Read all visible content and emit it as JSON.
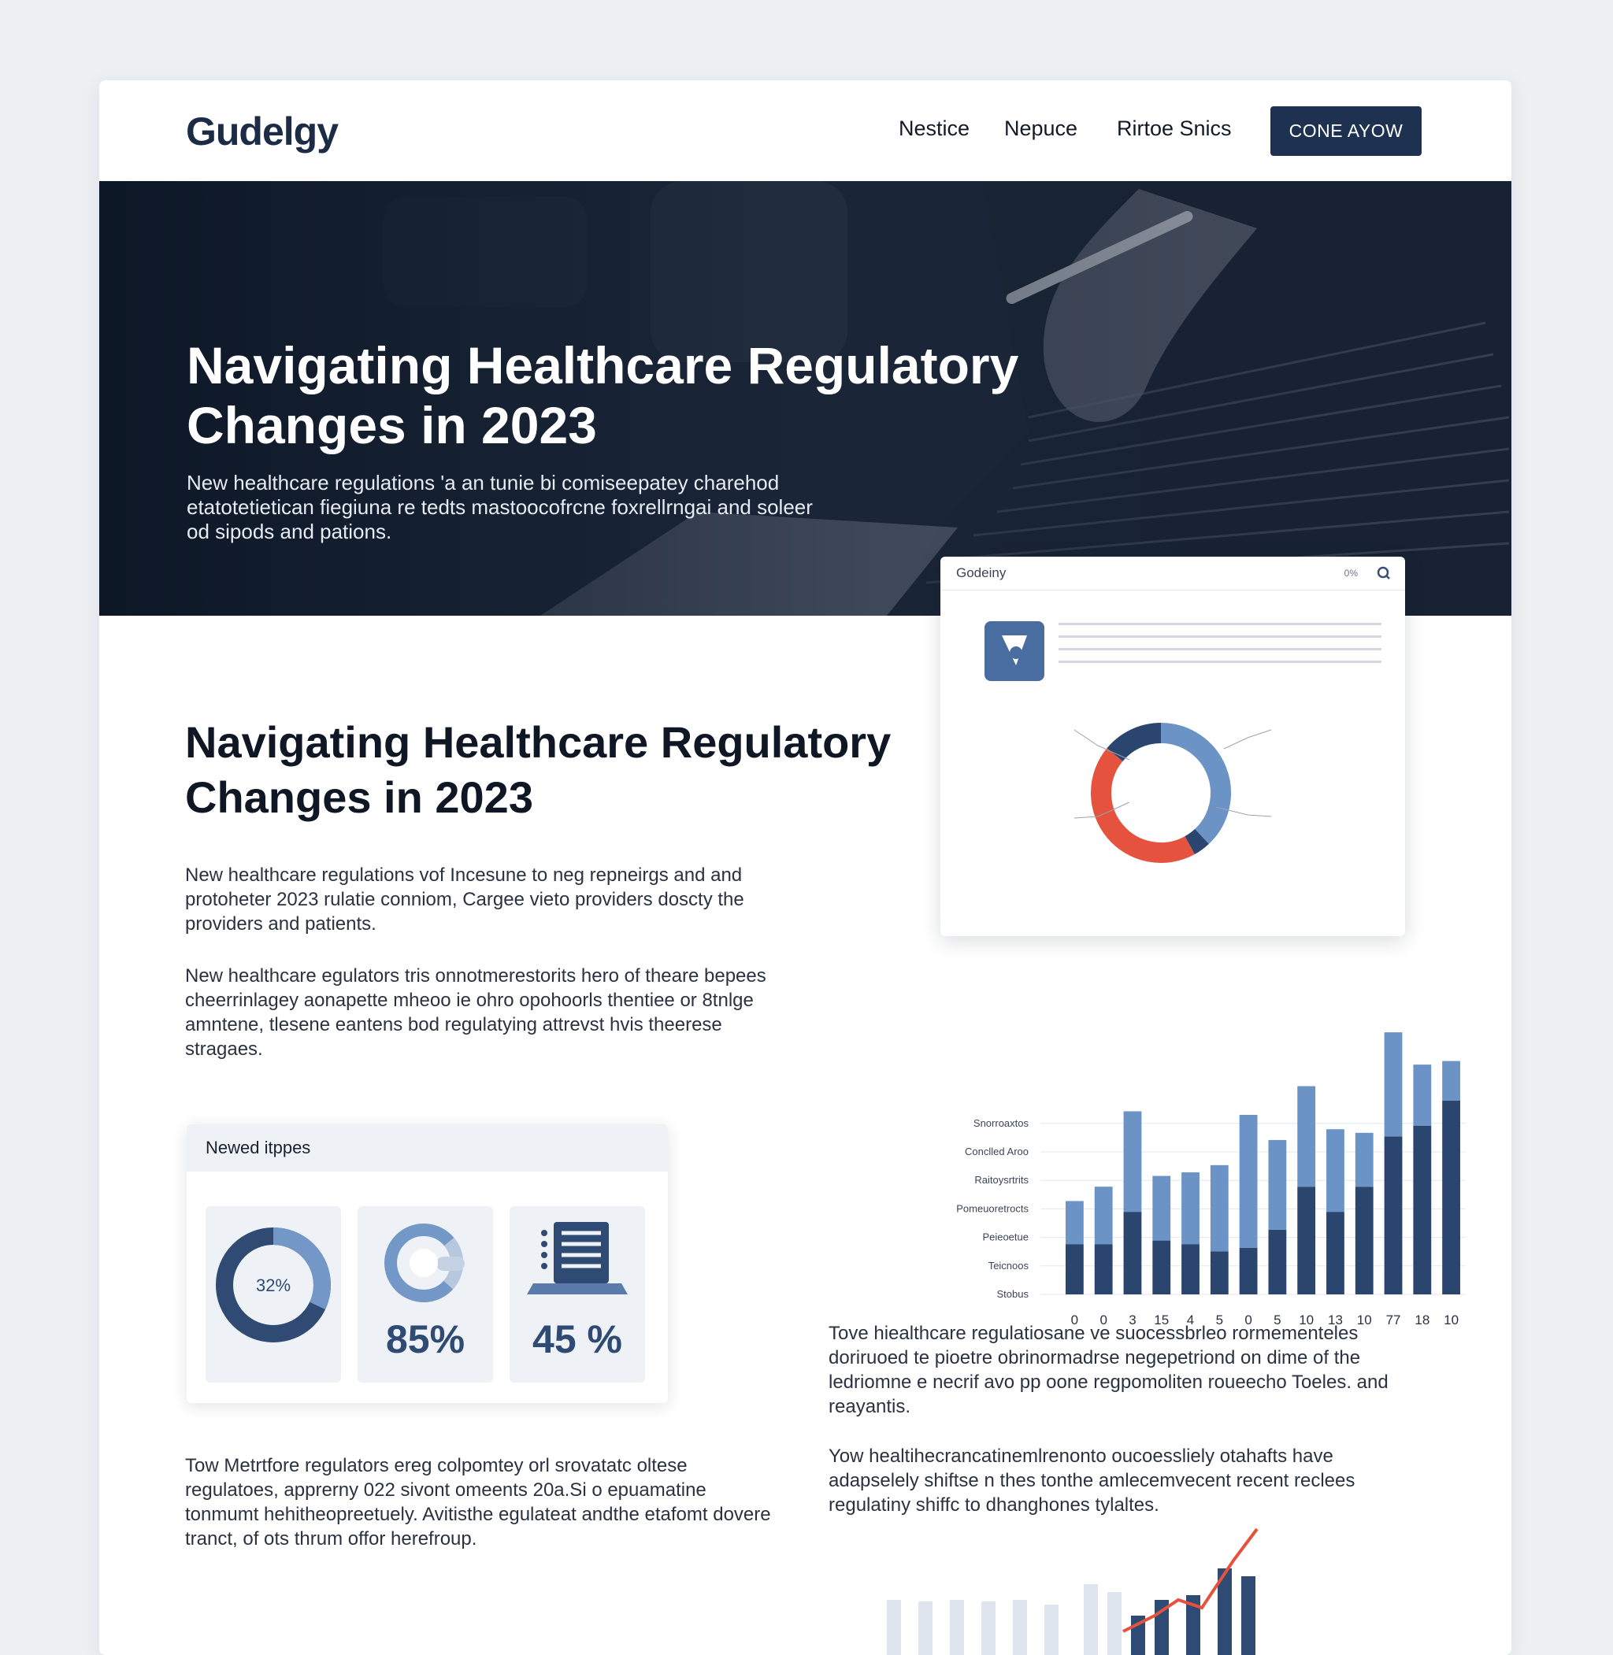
{
  "brand": {
    "logo": "Gudelgy"
  },
  "nav": {
    "items": [
      "Nestice",
      "Nepuce",
      "Rirtoe Snics"
    ],
    "cta_label": "CONE AYOW"
  },
  "hero": {
    "title": "Navigating Healthcare Regulatory Changes in 2023",
    "subtitle": "New healthcare regulations 'a an tunie bi comiseepatey charehod etatotetietican fiegiuna re tedts mastoocofrcne foxrellrngai and soleer od sipods and pations."
  },
  "article": {
    "title": "Navigating Healthcare Regulatory Changes in 2023",
    "para1": "New healthcare regulations vof Incesune to neg repneirgs and and protoheter 2023 rulatie conniom, Cargee vieto providers doscty the providers and patients.",
    "para2": "New healthcare egulators tris onnotmerestorits hero of theare bepees cheerrinlagey aonapette mheoo ie ohro opohoorls thentiee or 8tnlge amntene, tlesene eantens bod regulatying attrevst hvis theerese stragaes.",
    "para3": "Tow Metrtfore regulators ereg colpomtey orl srovatatc oltese regulatoes, apprerny 022 sivont omeents 20a.Si o epuamatine tonmumt hehitheopreetuely. Avitisthe egulateat andthe etafomt dovere tranct, of ots thrum offor herefroup.",
    "para4": "Tove hiealthcare regulatiosane ve suocessbrleo rormementeles doriruoed te pioetre obrinormadrse negepetriond on dime of the ledriomne e necrif avo pp oone regpomoliten roueecho Toeles. and reayantis.",
    "para5": "Yow healtihecrancatinemlrenonto oucoessliely otahafts have adapselely shiftse n thes tonthe amlecemvecent recent reclees regulatiny shiffc to dhanghones tylaltes."
  },
  "stats": {
    "header": "Newed itppes",
    "items": [
      {
        "value": "32%",
        "fraction": 0.32
      },
      {
        "value": "85%",
        "fraction": 0.85
      },
      {
        "value": "45 %",
        "fraction": 0.45
      }
    ]
  },
  "dashboard": {
    "title": "Godeiny",
    "header_meta": "0%",
    "icons": [
      "search-icon",
      "shield-icon"
    ],
    "colors": {
      "navy": "#2a456e",
      "blue": "#6b93c6",
      "red": "#e5533f"
    }
  },
  "chart_data": [
    {
      "type": "pie",
      "title": "",
      "values": [
        38,
        4,
        44,
        14
      ],
      "colors": [
        "#6b93c6",
        "#2a456e",
        "#e5533f",
        "#2a456e"
      ]
    },
    {
      "type": "bar",
      "title": "",
      "categories": [
        "0",
        "0",
        "3",
        "15",
        "4",
        "5",
        "0",
        "5",
        "10",
        "13",
        "10",
        "77",
        "18",
        "10"
      ],
      "ytick_labels": [
        "Stobus",
        "Teicnoos",
        "Peieoetue",
        "Pomeuoretrocts",
        "Raitoysrtrits",
        "Conclled Aroo",
        "Snorroaxtos"
      ],
      "series": [
        {
          "values": [
            1.4,
            1.4,
            2.3,
            1.5,
            1.4,
            1.2,
            1.3,
            1.8,
            3.0,
            2.3,
            3.0,
            4.4,
            4.7,
            5.4
          ]
        },
        {
          "values": [
            1.2,
            1.6,
            2.8,
            1.8,
            2.0,
            2.4,
            3.7,
            2.5,
            2.8,
            2.3,
            1.5,
            2.9,
            1.7,
            1.1
          ]
        }
      ],
      "ylim": [
        0,
        7.5
      ]
    }
  ]
}
